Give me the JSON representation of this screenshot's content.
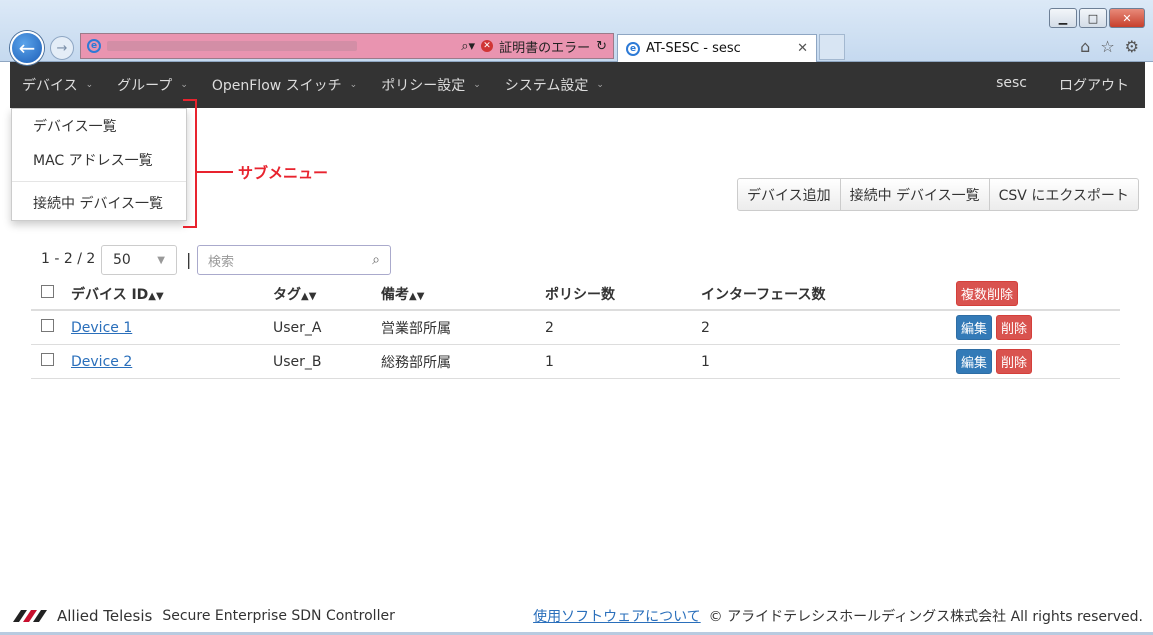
{
  "browser": {
    "tab_title": "AT-SESC - sesc",
    "cert_error": "証明書のエラー",
    "colors": {
      "address_bar": "#e994b0"
    }
  },
  "navbar": {
    "items": [
      {
        "label": "デバイス"
      },
      {
        "label": "グループ"
      },
      {
        "label": "OpenFlow スイッチ"
      },
      {
        "label": "ポリシー設定"
      },
      {
        "label": "システム設定"
      }
    ],
    "user": "sesc",
    "logout": "ログアウト"
  },
  "dropdown": {
    "items": [
      {
        "label": "デバイス一覧"
      },
      {
        "label": "MAC アドレス一覧"
      },
      {
        "label": "接続中 デバイス一覧"
      }
    ]
  },
  "annotation": {
    "label": "サブメニュー",
    "color": "#e8232e"
  },
  "actions": {
    "add": "デバイス追加",
    "connected": "接続中 デバイス一覧",
    "export": "CSV にエクスポート"
  },
  "paging": {
    "range": "1 - 2 / 2",
    "page_size": "50",
    "search_placeholder": "検索"
  },
  "table": {
    "headers": {
      "device_id": "デバイス ID",
      "tag": "タグ",
      "note": "備考",
      "policy_count": "ポリシー数",
      "interface_count": "インターフェース数",
      "bulk_delete": "複数削除"
    },
    "rows": [
      {
        "device": "Device 1",
        "tag": "User_A",
        "note": "営業部所属",
        "policy": "2",
        "iface": "2",
        "edit": "編集",
        "delete": "削除"
      },
      {
        "device": "Device 2",
        "tag": "User_B",
        "note": "総務部所属",
        "policy": "1",
        "iface": "1",
        "edit": "編集",
        "delete": "削除"
      }
    ]
  },
  "footer": {
    "brand": "Allied Telesis",
    "product": "Secure Enterprise SDN Controller",
    "software_link": "使用ソフトウェアについて",
    "copyright": "© アライドテレシスホールディングス株式会社 All rights reserved."
  }
}
